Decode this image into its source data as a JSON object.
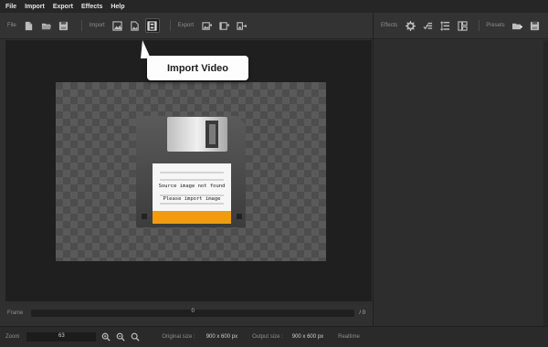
{
  "menu": [
    "File",
    "Import",
    "Export",
    "Effects",
    "Help"
  ],
  "toolbar": {
    "file_label": "File",
    "import_label": "Import",
    "export_label": "Export"
  },
  "right_toolbar": {
    "effects_label": "Effects",
    "presets_label": "Presets"
  },
  "tooltip": "Import Video",
  "placeholder_image": {
    "line1": "Source image not found",
    "line2": "Please import image",
    "accent_color": "#f29b11"
  },
  "frame": {
    "label": "Frame",
    "value": "0",
    "end": "/ 0"
  },
  "status": {
    "zoom_label": "Zoom",
    "zoom_value": "63",
    "original_label": "Original size :",
    "original_value": "900 x 600 px",
    "output_label": "Output size :",
    "output_value": "900 x 600 px",
    "realtime_label": "Realtime"
  }
}
